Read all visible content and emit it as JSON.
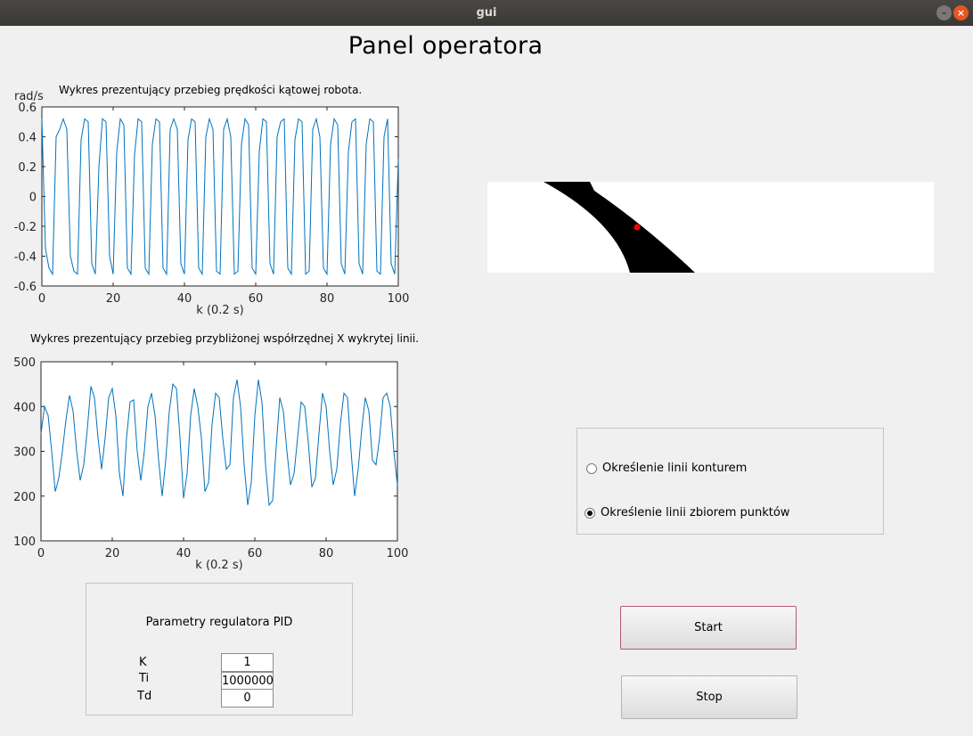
{
  "window": {
    "title": "gui"
  },
  "page_title": "Panel operatora",
  "chart_data": [
    {
      "type": "line",
      "title": "Wykres prezentujący przebieg prędkości kątowej robota.",
      "xlabel": "k (0.2 s)",
      "ylabel": "rad/s",
      "xlim": [
        0,
        100
      ],
      "ylim": [
        -0.6,
        0.6
      ],
      "xticks": [
        "0",
        "20",
        "40",
        "60",
        "80",
        "100"
      ],
      "yticks": [
        "0.6",
        "0.4",
        "0.2",
        "0",
        "-0.2",
        "-0.4",
        "-0.6"
      ],
      "line_color": "#0072bd",
      "series": [
        {
          "x": [
            0,
            1,
            2,
            3,
            4,
            5,
            6,
            7,
            8,
            9,
            10,
            11,
            12,
            13,
            14,
            15,
            16,
            17,
            18,
            19,
            20,
            21,
            22,
            23,
            24,
            25,
            26,
            27,
            28,
            29,
            30,
            31,
            32,
            33,
            34,
            35,
            36,
            37,
            38,
            39,
            40,
            41,
            42,
            43,
            44,
            45,
            46,
            47,
            48,
            49,
            50,
            51,
            52,
            53,
            54,
            55,
            56,
            57,
            58,
            59,
            60,
            61,
            62,
            63,
            64,
            65,
            66,
            67,
            68,
            69,
            70,
            71,
            72,
            73,
            74,
            75,
            76,
            77,
            78,
            79,
            80,
            81,
            82,
            83,
            84,
            85,
            86,
            87,
            88,
            89,
            90,
            91,
            92,
            93,
            94,
            95,
            96,
            97,
            98,
            99,
            100
          ],
          "y": [
            0.52,
            -0.35,
            -0.48,
            -0.52,
            0.4,
            0.45,
            0.52,
            0.45,
            -0.4,
            -0.5,
            -0.52,
            0.38,
            0.52,
            0.5,
            -0.45,
            -0.52,
            0.2,
            0.52,
            0.5,
            -0.4,
            -0.52,
            0.3,
            0.52,
            0.48,
            -0.48,
            -0.52,
            0.28,
            0.52,
            0.5,
            -0.48,
            -0.52,
            0.35,
            0.52,
            0.5,
            -0.48,
            -0.52,
            0.45,
            0.52,
            0.45,
            -0.45,
            -0.52,
            0.38,
            0.52,
            0.5,
            -0.48,
            -0.52,
            0.4,
            0.52,
            0.45,
            -0.5,
            -0.52,
            0.45,
            0.52,
            0.4,
            -0.52,
            -0.5,
            0.35,
            0.52,
            0.48,
            -0.48,
            -0.52,
            0.3,
            0.52,
            0.5,
            -0.45,
            -0.52,
            0.4,
            0.5,
            0.52,
            -0.48,
            -0.52,
            0.38,
            0.52,
            0.5,
            -0.52,
            -0.5,
            0.45,
            0.52,
            0.4,
            -0.48,
            -0.52,
            0.35,
            0.52,
            0.48,
            -0.45,
            -0.52,
            0.3,
            0.5,
            0.52,
            -0.45,
            -0.52,
            0.35,
            0.52,
            0.5,
            -0.5,
            -0.52,
            0.4,
            0.52,
            -0.45,
            -0.52,
            0.25
          ]
        }
      ]
    },
    {
      "type": "line",
      "title": "Wykres prezentujący przebieg przybliżonej współrzędnej X wykrytej linii.",
      "xlabel": "k (0.2 s)",
      "ylabel": "",
      "xlim": [
        0,
        100
      ],
      "ylim": [
        100,
        500
      ],
      "xticks": [
        "0",
        "20",
        "40",
        "60",
        "80",
        "100"
      ],
      "yticks": [
        "500",
        "400",
        "300",
        "200",
        "100"
      ],
      "line_color": "#0072bd",
      "series": [
        {
          "x": [
            0,
            1,
            2,
            3,
            4,
            5,
            6,
            7,
            8,
            9,
            10,
            11,
            12,
            13,
            14,
            15,
            16,
            17,
            18,
            19,
            20,
            21,
            22,
            23,
            24,
            25,
            26,
            27,
            28,
            29,
            30,
            31,
            32,
            33,
            34,
            35,
            36,
            37,
            38,
            39,
            40,
            41,
            42,
            43,
            44,
            45,
            46,
            47,
            48,
            49,
            50,
            51,
            52,
            53,
            54,
            55,
            56,
            57,
            58,
            59,
            60,
            61,
            62,
            63,
            64,
            65,
            66,
            67,
            68,
            69,
            70,
            71,
            72,
            73,
            74,
            75,
            76,
            77,
            78,
            79,
            80,
            81,
            82,
            83,
            84,
            85,
            86,
            87,
            88,
            89,
            90,
            91,
            92,
            93,
            94,
            95,
            96,
            97,
            98,
            99,
            100
          ],
          "y": [
            340,
            400,
            380,
            300,
            210,
            240,
            300,
            370,
            425,
            390,
            300,
            235,
            270,
            350,
            445,
            420,
            330,
            260,
            330,
            420,
            440,
            380,
            250,
            200,
            330,
            410,
            415,
            300,
            235,
            300,
            400,
            430,
            380,
            280,
            200,
            280,
            390,
            450,
            440,
            330,
            195,
            250,
            380,
            440,
            400,
            330,
            210,
            230,
            360,
            430,
            420,
            330,
            260,
            270,
            420,
            460,
            400,
            270,
            180,
            230,
            380,
            460,
            410,
            270,
            180,
            190,
            310,
            420,
            390,
            300,
            225,
            250,
            330,
            410,
            400,
            320,
            220,
            240,
            340,
            430,
            400,
            300,
            225,
            260,
            360,
            430,
            420,
            300,
            200,
            260,
            350,
            420,
            390,
            280,
            270,
            330,
            420,
            430,
            400,
            300,
            225
          ]
        }
      ]
    }
  ],
  "image_panel": {
    "marker_color": "#ff0000"
  },
  "radio_group": {
    "options": [
      {
        "label": "Określenie linii konturem",
        "selected": false
      },
      {
        "label": "Określenie linii zbiorem punktów",
        "selected": true
      }
    ]
  },
  "buttons": {
    "start": "Start",
    "stop": "Stop"
  },
  "pid": {
    "title": "Parametry regulatora PID",
    "labels": {
      "k": "K",
      "ti": "Ti",
      "td": "Td"
    },
    "values": {
      "k": "1",
      "ti": "1000000",
      "td": "0"
    }
  }
}
